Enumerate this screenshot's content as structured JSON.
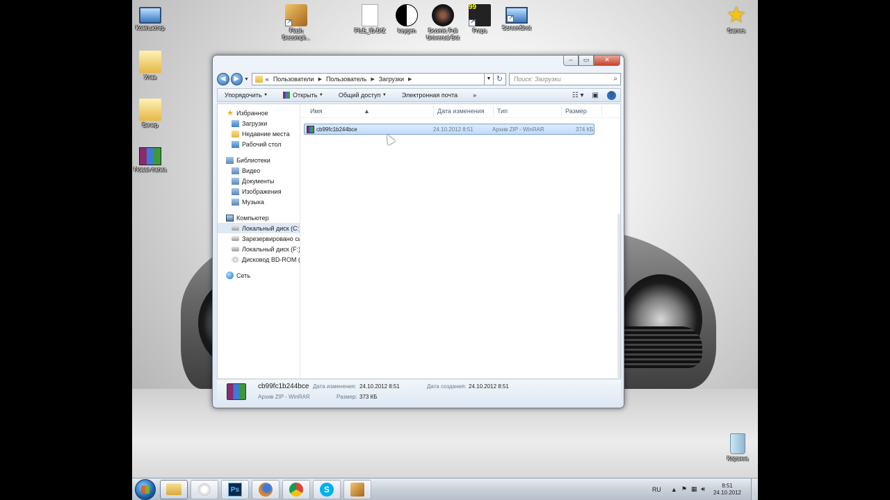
{
  "desktop": {
    "icons": [
      {
        "id": "computer",
        "label": "Компьютер"
      },
      {
        "id": "flash",
        "label": "Flash\nDecompil..."
      },
      {
        "id": "file",
        "label": "FILE_ID.DIZ"
      },
      {
        "id": "keygen",
        "label": "keygen"
      },
      {
        "id": "bot",
        "label": "Dcomic Full\nUniversal Bot"
      },
      {
        "id": "fraps",
        "label": "Fraps"
      },
      {
        "id": "screenshot",
        "label": "ScreenShot"
      },
      {
        "id": "games",
        "label": "Games"
      },
      {
        "id": "folder1",
        "label": "Улав"
      },
      {
        "id": "folder2",
        "label": "Вечер"
      },
      {
        "id": "newfolder",
        "label": "Новая папка"
      },
      {
        "id": "recycle",
        "label": "Корзина"
      }
    ]
  },
  "window": {
    "address": {
      "overflow": "«",
      "segments": [
        "Пользователи",
        "Пользователь",
        "Загрузки"
      ]
    },
    "search_placeholder": "Поиск: Загрузки",
    "toolbar": {
      "organize": "Упорядочить",
      "open": "Открыть",
      "share": "Общий доступ",
      "email": "Электронная почта",
      "more": "»"
    },
    "nav": {
      "favorites": "Избранное",
      "fav_items": [
        "Загрузки",
        "Недавние места",
        "Рабочий стол"
      ],
      "libraries": "Библиотеки",
      "lib_items": [
        "Видео",
        "Документы",
        "Изображения",
        "Музыка"
      ],
      "computer": "Компьютер",
      "comp_items": [
        "Локальный диск (C:)",
        "Зарезервировано системой",
        "Локальный диск (F:)",
        "Дисковод BD-ROM (J:)"
      ],
      "network": "Сеть"
    },
    "columns": {
      "name": "Имя",
      "date": "Дата изменения",
      "type": "Тип",
      "size": "Размер"
    },
    "file": {
      "name": "cb99fc1b244bce",
      "date": "24.10.2012 8:51",
      "type": "Архив ZIP - WinRAR",
      "size": "374 КБ"
    },
    "details": {
      "name": "cb99fc1b244bce",
      "type": "Архив ZIP - WinRAR",
      "modified_label": "Дата изменения:",
      "modified": "24.10.2012 8:51",
      "size_label": "Размер:",
      "size": "373 КБ",
      "created_label": "Дата создания:",
      "created": "24.10.2012 8:51"
    }
  },
  "taskbar": {
    "apps": [
      "explorer",
      "wmp",
      "photoshop",
      "firefox",
      "chrome",
      "skype",
      "flash"
    ],
    "ps_label": "Ps",
    "language": "RU",
    "time": "8:51",
    "date": "24.10.2012"
  }
}
